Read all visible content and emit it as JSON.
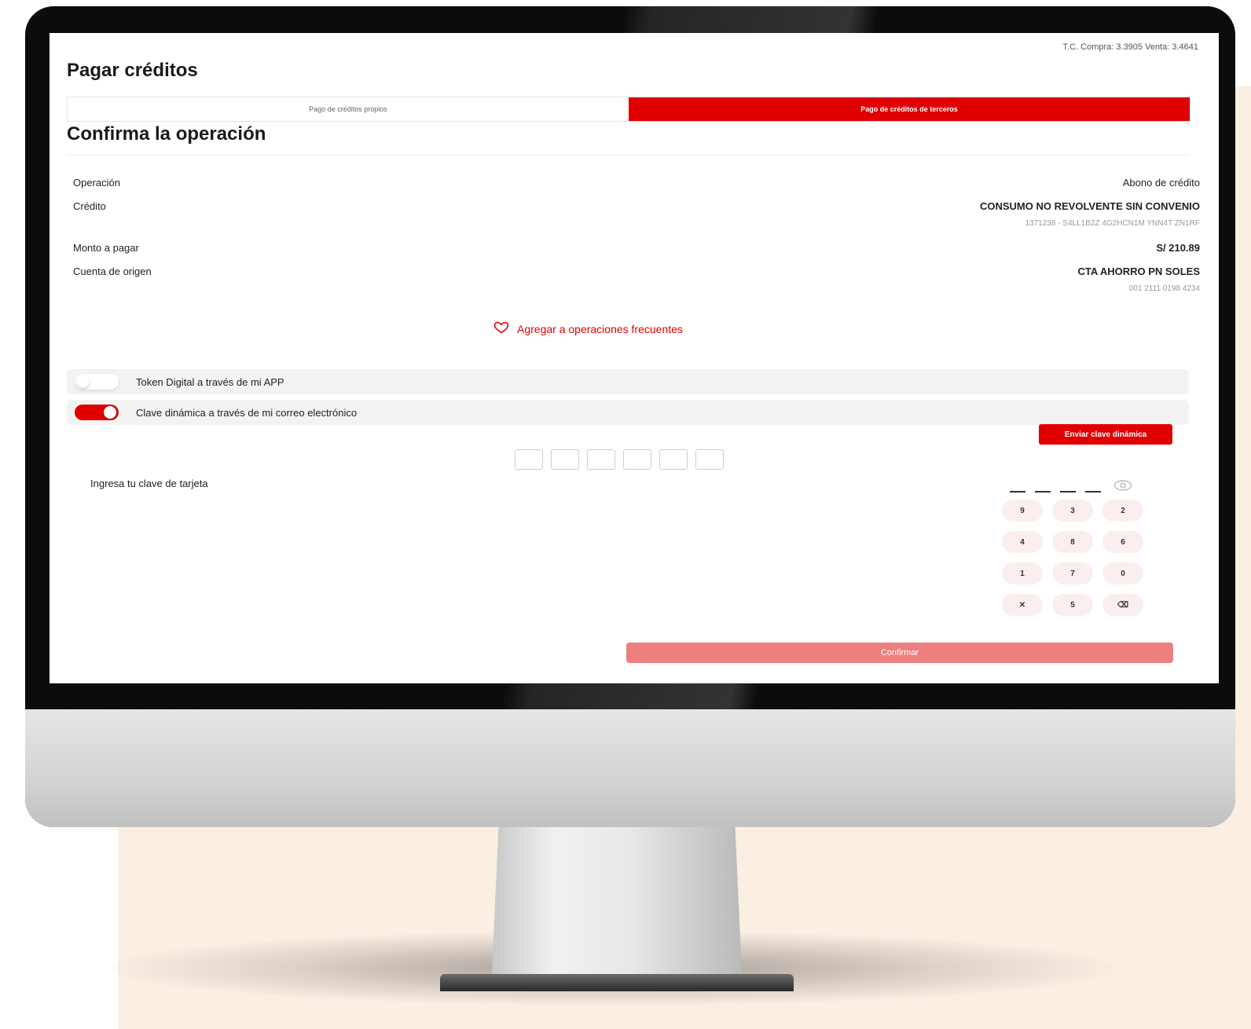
{
  "header": {
    "exchange_rate": "T.C. Compra: 3.3905 Venta: 3.4641",
    "title": "Pagar créditos"
  },
  "tabs": [
    {
      "label": "Pago de créditos propios",
      "active": false
    },
    {
      "label": "Pago de créditos de terceros",
      "active": true
    }
  ],
  "confirm": {
    "section_title": "Confirma la operación",
    "rows": [
      {
        "label": "Operación",
        "value": "Abono de crédito",
        "sub": ""
      },
      {
        "label": "Crédito",
        "value": "CONSUMO NO REVOLVENTE SIN CONVENIO",
        "sub": "1371238 - S4LL1B2Z 4G2HCN1M YNN4T ZN1RF"
      },
      {
        "label": "Monto a pagar",
        "value": "S/ 210.89",
        "sub": ""
      },
      {
        "label": "Cuenta de origen",
        "value": "CTA AHORRO PN SOLES",
        "sub": "001 2111 0198 4234"
      }
    ],
    "favorite_label": "Agregar a operaciones frecuentes"
  },
  "auth": {
    "options": [
      {
        "label": "Token Digital a través de mi APP",
        "enabled": false
      },
      {
        "label": "Clave dinámica a través de mi correo electrónico",
        "enabled": true
      }
    ],
    "send_label": "Enviar clave dinámica"
  },
  "pin": {
    "label": "Ingresa tu clave de tarjeta",
    "keys": [
      "9",
      "3",
      "2",
      "4",
      "8",
      "6",
      "1",
      "7",
      "0",
      "✕",
      "5",
      "⌫"
    ]
  },
  "confirm_button": "Confirmar",
  "colors": {
    "brand": "#e00000",
    "confirm_disabled": "#ee7f7f",
    "background_blob": "#fbeee3"
  }
}
